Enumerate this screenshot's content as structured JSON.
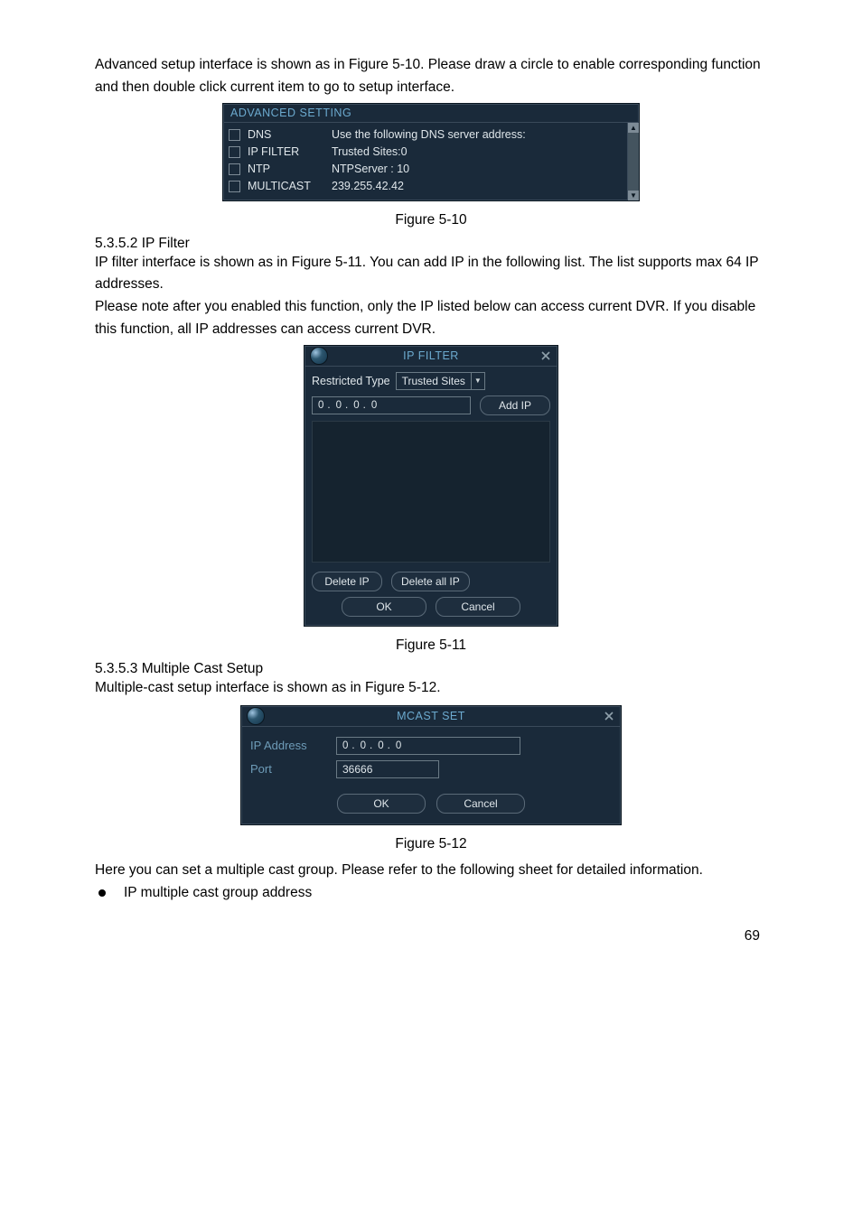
{
  "page_number": "69",
  "para_intro_adv": "Advanced setup interface is shown as in Figure 5-10. Please draw a circle to enable corresponding function and then double click current item to go to setup interface.",
  "fig510_caption": "Figure 5-10",
  "section_ipfilter_heading": "5.3.5.2  IP Filter",
  "para_ipf_1": "IP filter interface is shown as in Figure 5-11. You can add IP in the following list.  The list supports max 64 IP addresses.",
  "para_ipf_2": "Please note after you enabled this function, only the IP listed below can access current DVR. If you disable this function, all IP addresses can access current DVR.",
  "fig511_caption": "Figure 5-11",
  "section_mcast_heading": "5.3.5.3  Multiple Cast Setup",
  "para_mcast_intro": "Multiple-cast setup interface is shown as in Figure 5-12.",
  "fig512_caption": "Figure 5-12",
  "para_outro_mcast": "Here you can set a multiple cast group. Please refer to the following sheet for detailed information.",
  "bullet_1": "IP multiple cast group address",
  "advanced": {
    "title": "ADVANCED SETTING",
    "items": [
      {
        "label": "DNS",
        "desc": "Use the following DNS server address:"
      },
      {
        "label": "IP FILTER",
        "desc": "Trusted Sites:0"
      },
      {
        "label": "NTP",
        "desc": "NTPServer : 10"
      },
      {
        "label": "MULTICAST",
        "desc": "239.255.42.42"
      }
    ]
  },
  "ipfilter": {
    "title": "IP FILTER",
    "restricted_label": "Restricted Type",
    "combo_value": "Trusted Sites",
    "ip_octets": [
      "0",
      "0",
      "0",
      "0"
    ],
    "add_label": "Add IP",
    "delete_ip": "Delete IP",
    "delete_all": "Delete all IP",
    "ok": "OK",
    "cancel": "Cancel"
  },
  "mcast": {
    "title": "MCAST SET",
    "ip_label": "IP Address",
    "port_label": "Port",
    "ip_octets": [
      "0",
      "0",
      "0",
      "0"
    ],
    "port_value": "36666",
    "ok": "OK",
    "cancel": "Cancel"
  }
}
